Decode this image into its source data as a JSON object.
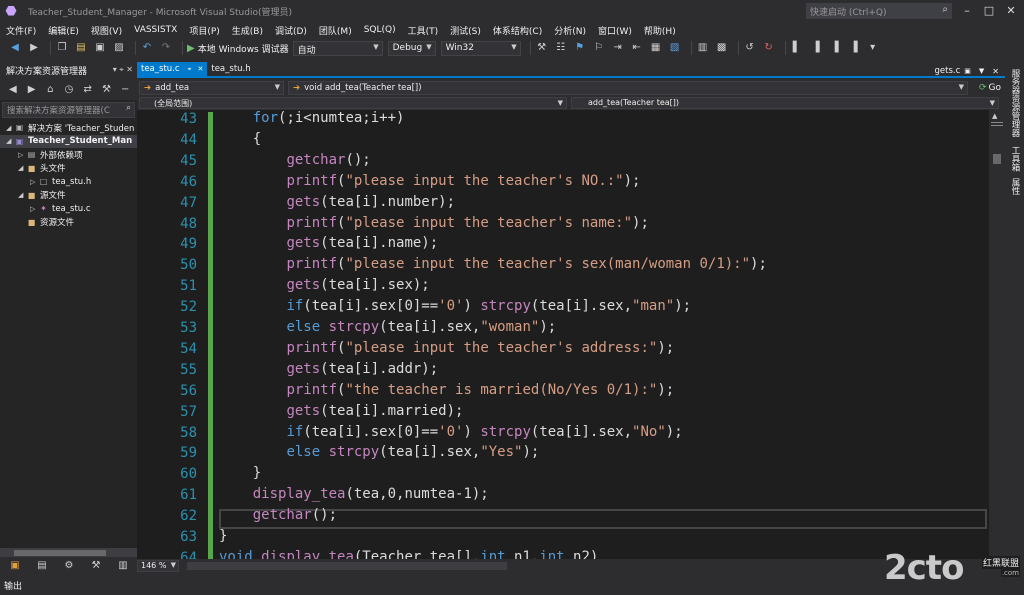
{
  "window": {
    "title": "Teacher_Student_Manager - Microsoft Visual Studio(管理员)",
    "quick_launch_placeholder": "快速启动 (Ctrl+Q)"
  },
  "menu": [
    "文件(F)",
    "编辑(E)",
    "视图(V)",
    "VASSISTX",
    "项目(P)",
    "生成(B)",
    "调试(D)",
    "团队(M)",
    "SQL(Q)",
    "工具(T)",
    "测试(S)",
    "体系结构(C)",
    "分析(N)",
    "窗口(W)",
    "帮助(H)"
  ],
  "toolbar": {
    "run_label": "本地 Windows 调试器",
    "run_mode": "自动",
    "configuration": "Debug",
    "platform": "Win32"
  },
  "solution_explorer": {
    "title": "解决方案资源管理器",
    "search_placeholder": "搜索解决方案资源管理器(C",
    "items": [
      {
        "label": "解决方案 'Teacher_Studen",
        "depth": 0,
        "icon": "solution-icon"
      },
      {
        "label": "Teacher_Student_Man",
        "depth": 0,
        "icon": "project-icon",
        "selected": true
      },
      {
        "label": "外部依赖项",
        "depth": 1,
        "icon": "dependencies-icon"
      },
      {
        "label": "头文件",
        "depth": 1,
        "icon": "folder-icon"
      },
      {
        "label": "tea_stu.h",
        "depth": 2,
        "icon": "header-file-icon"
      },
      {
        "label": "源文件",
        "depth": 1,
        "icon": "folder-icon"
      },
      {
        "label": "tea_stu.c",
        "depth": 2,
        "icon": "source-file-icon"
      },
      {
        "label": "资源文件",
        "depth": 1,
        "icon": "folder-icon"
      }
    ]
  },
  "editor": {
    "tabs": [
      {
        "label": "tea_stu.c",
        "active": true
      },
      {
        "label": "tea_stu.h",
        "active": false
      }
    ],
    "right_tab": "gets.c",
    "nav_scope": "add_tea",
    "nav_function": "void add_tea(Teacher tea[])",
    "nav_go": "Go",
    "nav_global": "(全局范围)",
    "nav_member": "add_tea(Teacher tea[])",
    "zoom": "146 %",
    "current_line": 62,
    "lines": [
      {
        "no": "43",
        "text": "    for(;i<numtea;i++)"
      },
      {
        "no": "44",
        "text": "    {"
      },
      {
        "no": "45",
        "text": "        getchar();"
      },
      {
        "no": "46",
        "text": "        printf(\"please input the teacher's NO.:\");"
      },
      {
        "no": "47",
        "text": "        gets(tea[i].number);"
      },
      {
        "no": "48",
        "text": "        printf(\"please input the teacher's name:\");"
      },
      {
        "no": "49",
        "text": "        gets(tea[i].name);"
      },
      {
        "no": "50",
        "text": "        printf(\"please input the teacher's sex(man/woman 0/1):\");"
      },
      {
        "no": "51",
        "text": "        gets(tea[i].sex);"
      },
      {
        "no": "52",
        "text": "        if(tea[i].sex[0]=='0') strcpy(tea[i].sex,\"man\");"
      },
      {
        "no": "53",
        "text": "        else strcpy(tea[i].sex,\"woman\");"
      },
      {
        "no": "54",
        "text": "        printf(\"please input the teacher's address:\");"
      },
      {
        "no": "55",
        "text": "        gets(tea[i].addr);"
      },
      {
        "no": "56",
        "text": "        printf(\"the teacher is married(No/Yes 0/1):\");"
      },
      {
        "no": "57",
        "text": "        gets(tea[i].married);"
      },
      {
        "no": "58",
        "text": "        if(tea[i].sex[0]=='0') strcpy(tea[i].sex,\"No\");"
      },
      {
        "no": "59",
        "text": "        else strcpy(tea[i].sex,\"Yes\");"
      },
      {
        "no": "60",
        "text": "    }"
      },
      {
        "no": "61",
        "text": "    display_tea(tea,0,numtea-1);"
      },
      {
        "no": "62",
        "text": "    getchar();"
      },
      {
        "no": "63",
        "text": "}"
      },
      {
        "no": "64",
        "text": "void display_tea(Teacher tea[],int n1,int n2)"
      }
    ]
  },
  "right_panel": [
    "服务器资源管理器",
    "工具箱",
    "属性"
  ],
  "output_panel": "输出",
  "watermark": {
    "logo": "2cto",
    "site": "红黑联盟",
    "url": ".com"
  }
}
